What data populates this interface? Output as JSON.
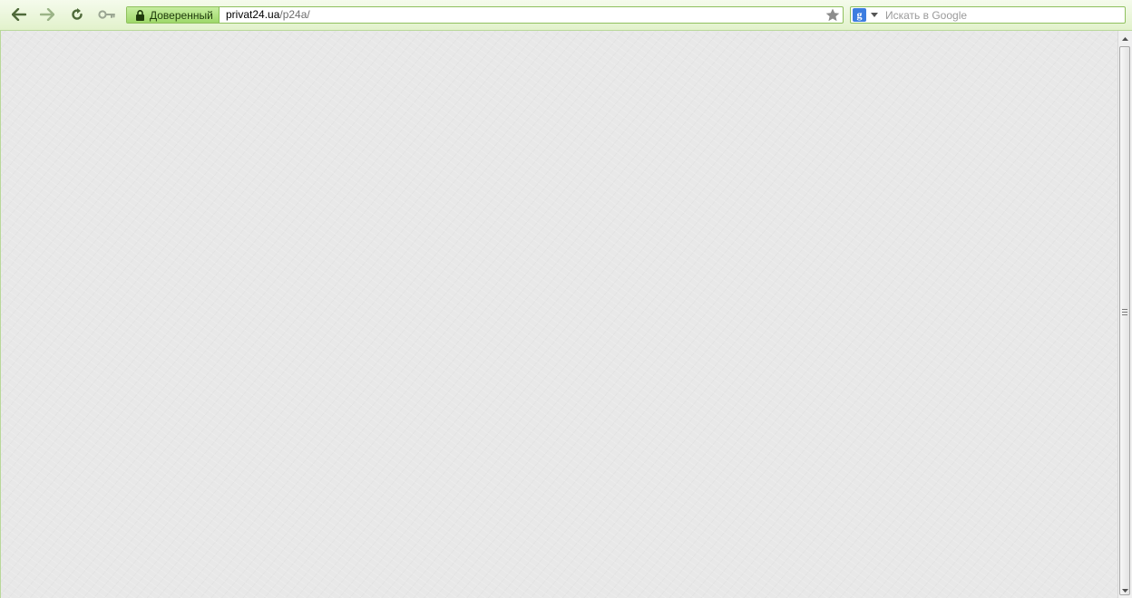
{
  "toolbar": {
    "back_icon": "back-arrow-icon",
    "forward_icon": "forward-arrow-icon",
    "reload_icon": "reload-icon",
    "key_icon": "key-icon"
  },
  "urlbar": {
    "identity_label": "Доверенный",
    "url_domain": "privat24.ua",
    "url_path": "/p24a/",
    "bookmark_icon": "star-icon"
  },
  "search": {
    "engine_logo": "g",
    "placeholder": "Искать в Google"
  },
  "colors": {
    "toolbar_bg": "#e2f2cc",
    "identity_bg": "#9fd86a",
    "content_bg": "#e8e8e8"
  }
}
